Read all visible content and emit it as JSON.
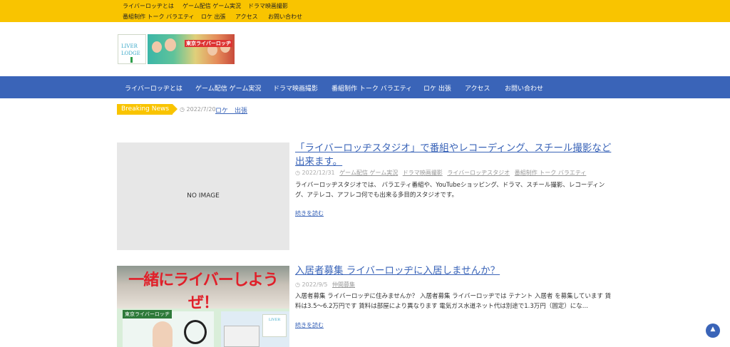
{
  "top_menu": {
    "items": [
      "ライバーロッヂとは",
      "ゲーム配信 ゲーム実況",
      "ドラマ映画撮影",
      "番組制作 トーク バラエティ",
      "ロケ 出張",
      "アクセス",
      "お問い合わせ"
    ]
  },
  "logo": {
    "text_a_line1": "LIVER",
    "text_a_line2": "LODGE",
    "banner_text": "東京ライバーロッヂ"
  },
  "main_nav": {
    "items": [
      "ライバーロッヂとは",
      "ゲーム配信 ゲーム実況",
      "ドラマ映画撮影",
      "番組制作 トーク バラエティ",
      "ロケ 出張",
      "アクセス",
      "お問い合わせ"
    ]
  },
  "breaking_news": {
    "label": "Breaking News",
    "date": "2022/7/20",
    "title": "ロケ　出張"
  },
  "posts": [
    {
      "thumbnail_text": "NO IMAGE",
      "title": "「ライバーロッヂスタジオ」で番組やレコーディング、スチール撮影など出来ます。",
      "date": "2022/12/31",
      "categories": [
        "ゲーム配信 ゲーム実況",
        "ドラマ映画撮影",
        "ライバーロッヂスタジオ",
        "番組制作 トーク バラエティ"
      ],
      "excerpt": "ライバーロッヂスタジオでは、 バラエティ番組や、YouTubeショッピング、ドラマ、スチール撮影、レコーディング、アテレコ、アフレコ何でも出来る多目的スタジオです。",
      "read_more": "続きを読む"
    },
    {
      "thumbnail_slogan": "一緒にライバーしようぜ！",
      "thumbnail_tag": "東京ライバーロッヂ",
      "title": "入居者募集 ライバーロッヂに入居しませんか？",
      "date": "2022/9/5",
      "categories": [
        "仲間募集"
      ],
      "excerpt": "入居者募集 ライバーロッヂに住みませんか？ 入居者募集 ライバーロッヂでは テナント 入居者 を募集しています 賃料は3.5〜6.2万円です 賃料は部屋により異なります 電気ガス水道ネット代は別途で1.3万円（固定）にな...",
      "read_more": "続きを読む"
    }
  ],
  "colors": {
    "top_bar": "#f9c400",
    "nav_bar": "#3a64b8",
    "link": "#3a64b8"
  },
  "icons": {
    "clock": "clock-icon",
    "back_to_top": "chevron-up-icon"
  }
}
